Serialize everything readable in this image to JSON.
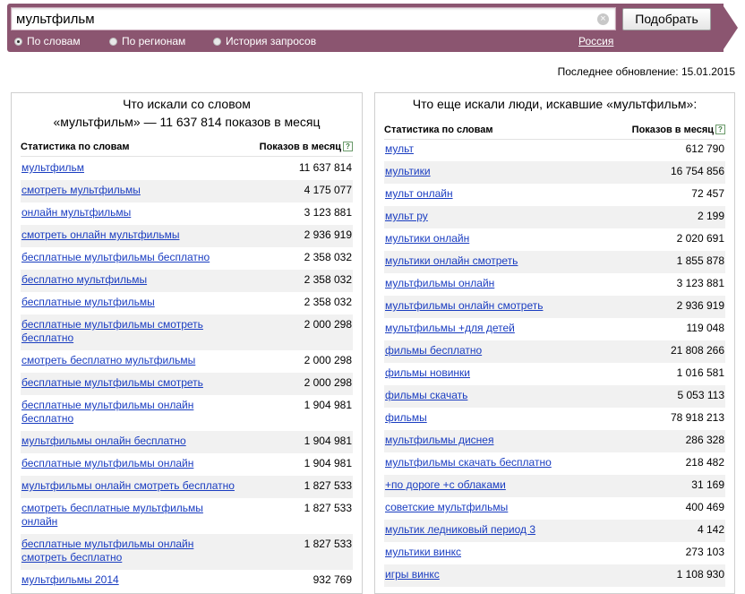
{
  "search": {
    "query": "мультфильм",
    "button_label": "Подобрать",
    "clear_glyph": "×"
  },
  "modes": {
    "items": [
      "По словам",
      "По регионам",
      "История запросов"
    ],
    "selected": 0
  },
  "region": "Россия",
  "updated": "Последнее обновление: 15.01.2015",
  "left": {
    "title_line1": "Что искали со словом",
    "title_line2": "«мультфильм» — 11 637 814 показов в месяц",
    "col_keyword": "Статистика по словам",
    "col_shows": "Показов в месяц",
    "help_glyph": "?",
    "rows": [
      {
        "kw": "мультфильм",
        "val": "11 637 814"
      },
      {
        "kw": "смотреть мультфильмы",
        "val": "4 175 077"
      },
      {
        "kw": "онлайн мультфильмы",
        "val": "3 123 881"
      },
      {
        "kw": "смотреть онлайн мультфильмы",
        "val": "2 936 919"
      },
      {
        "kw": "бесплатные мультфильмы бесплатно",
        "val": "2 358 032"
      },
      {
        "kw": "бесплатно мультфильмы",
        "val": "2 358 032"
      },
      {
        "kw": "бесплатные мультфильмы",
        "val": "2 358 032"
      },
      {
        "kw": "бесплатные мультфильмы смотреть бесплатно",
        "val": "2 000 298"
      },
      {
        "kw": "смотреть бесплатно мультфильмы",
        "val": "2 000 298"
      },
      {
        "kw": "бесплатные мультфильмы смотреть",
        "val": "2 000 298"
      },
      {
        "kw": "бесплатные мультфильмы онлайн бесплатно",
        "val": "1 904 981"
      },
      {
        "kw": "мультфильмы онлайн бесплатно",
        "val": "1 904 981"
      },
      {
        "kw": "бесплатные мультфильмы онлайн",
        "val": "1 904 981"
      },
      {
        "kw": "мультфильмы онлайн смотреть бесплатно",
        "val": "1 827 533"
      },
      {
        "kw": "смотреть бесплатные мультфильмы онлайн",
        "val": "1 827 533"
      },
      {
        "kw": "бесплатные мультфильмы онлайн смотреть бесплатно",
        "val": "1 827 533"
      },
      {
        "kw": "мультфильмы 2014",
        "val": "932 769"
      }
    ]
  },
  "right": {
    "title": "Что еще искали люди, искавшие «мультфильм»:",
    "col_keyword": "Статистика по словам",
    "col_shows": "Показов в месяц",
    "rows": [
      {
        "kw": "мульт",
        "val": "612 790"
      },
      {
        "kw": "мультики",
        "val": "16 754 856"
      },
      {
        "kw": "мульт онлайн",
        "val": "72 457"
      },
      {
        "kw": "мульт ру",
        "val": "2 199"
      },
      {
        "kw": "мультики онлайн",
        "val": "2 020 691"
      },
      {
        "kw": "мультики онлайн смотреть",
        "val": "1 855 878"
      },
      {
        "kw": "мультфильмы онлайн",
        "val": "3 123 881"
      },
      {
        "kw": "мультфильмы онлайн смотреть",
        "val": "2 936 919"
      },
      {
        "kw": "мультфильмы +для детей",
        "val": "119 048"
      },
      {
        "kw": "фильмы бесплатно",
        "val": "21 808 266"
      },
      {
        "kw": "фильмы новинки",
        "val": "1 016 581"
      },
      {
        "kw": "фильмы скачать",
        "val": "5 053 113"
      },
      {
        "kw": "фильмы",
        "val": "78 918 213"
      },
      {
        "kw": "мультфильмы диснея",
        "val": "286 328"
      },
      {
        "kw": "мультфильмы скачать бесплатно",
        "val": "218 482"
      },
      {
        "kw": "+по дороге +с облаками",
        "val": "31 169"
      },
      {
        "kw": "советские мультфильмы",
        "val": "400 469"
      },
      {
        "kw": "мультик ледниковый период 3",
        "val": "4 142"
      },
      {
        "kw": "мультики винкс",
        "val": "273 103"
      },
      {
        "kw": "игры винкс",
        "val": "1 108 930"
      }
    ]
  },
  "colors": {
    "header_bg": "#8b5570",
    "link": "#1a3dc1",
    "row_alt": "#f1f1f1"
  }
}
